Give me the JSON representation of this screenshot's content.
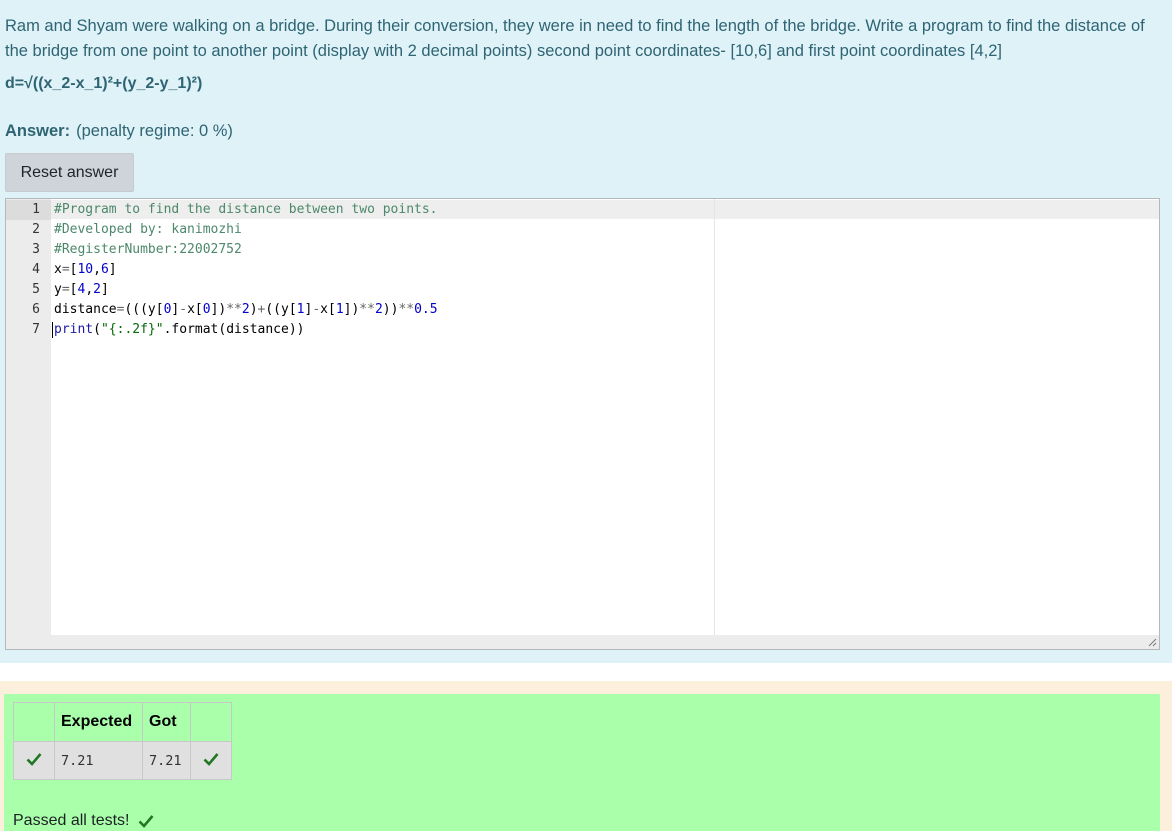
{
  "question": {
    "text": "Ram and Shyam were walking on a bridge. During their conversion, they were in need to find the length of the bridge. Write a program to find the distance of the bridge from one point to another point (display with 2 decimal points) second point coordinates- [10,6] and first point coordinates [4,2]",
    "formula": "d=√((x_2-x_1)²+(y_2-y_1)²)"
  },
  "answer": {
    "label": "Answer:",
    "penalty": "(penalty regime: 0 %)",
    "reset_label": "Reset answer"
  },
  "editor": {
    "line_numbers": [
      "1",
      "2",
      "3",
      "4",
      "5",
      "6",
      "7"
    ],
    "lines": [
      "#Program to find the distance between two points.",
      "#Developed by: kanimozhi",
      "#RegisterNumber:22002752",
      "x=[10,6]",
      "y=[4,2]",
      "distance=(((y[0]-x[0])**2)+((y[1]-x[1])**2))**0.5",
      "print(\"{:.2f}\".format(distance))"
    ]
  },
  "results": {
    "headers": [
      "",
      "Expected",
      "Got",
      ""
    ],
    "rows": [
      {
        "expected": "7.21",
        "got": "7.21"
      }
    ],
    "passed_text": "Passed all tests!",
    "pass_color": "#227722"
  }
}
